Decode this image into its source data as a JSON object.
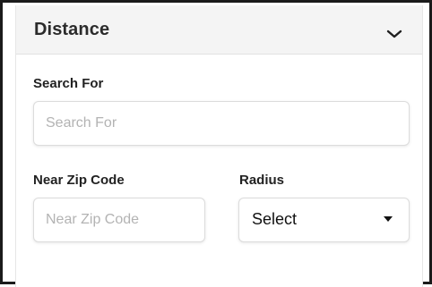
{
  "section": {
    "title": "Distance",
    "toggle_icon": "chevron-down-icon"
  },
  "search": {
    "label": "Search For",
    "placeholder": "Search For",
    "value": ""
  },
  "zip": {
    "label": "Near Zip Code",
    "placeholder": "Near Zip Code",
    "value": ""
  },
  "radius": {
    "label": "Radius",
    "selected": "Select",
    "caret_icon": "caret-down-icon"
  }
}
